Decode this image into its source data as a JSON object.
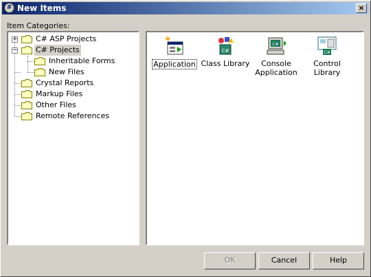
{
  "window": {
    "title": "New Items",
    "close_glyph": "×",
    "app_icon": "#"
  },
  "categories_label": "Item Categories:",
  "tree": {
    "expander_collapsed": "+",
    "expander_expanded": "−",
    "items": [
      {
        "label": "C# ASP Projects",
        "icon": "folder-icon",
        "state": "collapsed"
      },
      {
        "label": "C# Projects",
        "icon": "folder-icon",
        "state": "expanded",
        "selected": true
      },
      {
        "label": "Inheritable Forms",
        "icon": "folder-icon"
      },
      {
        "label": "New Files",
        "icon": "folder-icon"
      },
      {
        "label": "Crystal Reports",
        "icon": "folder-icon"
      },
      {
        "label": "Markup Files",
        "icon": "folder-icon"
      },
      {
        "label": "Other Files",
        "icon": "folder-icon"
      },
      {
        "label": "Remote References",
        "icon": "folder-icon"
      }
    ]
  },
  "templates": [
    {
      "label": "Application",
      "icon": "application-icon",
      "focused": true
    },
    {
      "label": "Class Library",
      "icon": "class-library-icon"
    },
    {
      "label": "Console Application",
      "icon": "console-application-icon"
    },
    {
      "label": "Control Library",
      "icon": "control-library-icon"
    }
  ],
  "buttons": {
    "ok": "OK",
    "cancel": "Cancel",
    "help": "Help"
  },
  "colors": {
    "title_start": "#0a246a",
    "title_end": "#a6caf0",
    "folder_fill": "#ffffc0",
    "folder_stroke": "#808000"
  }
}
